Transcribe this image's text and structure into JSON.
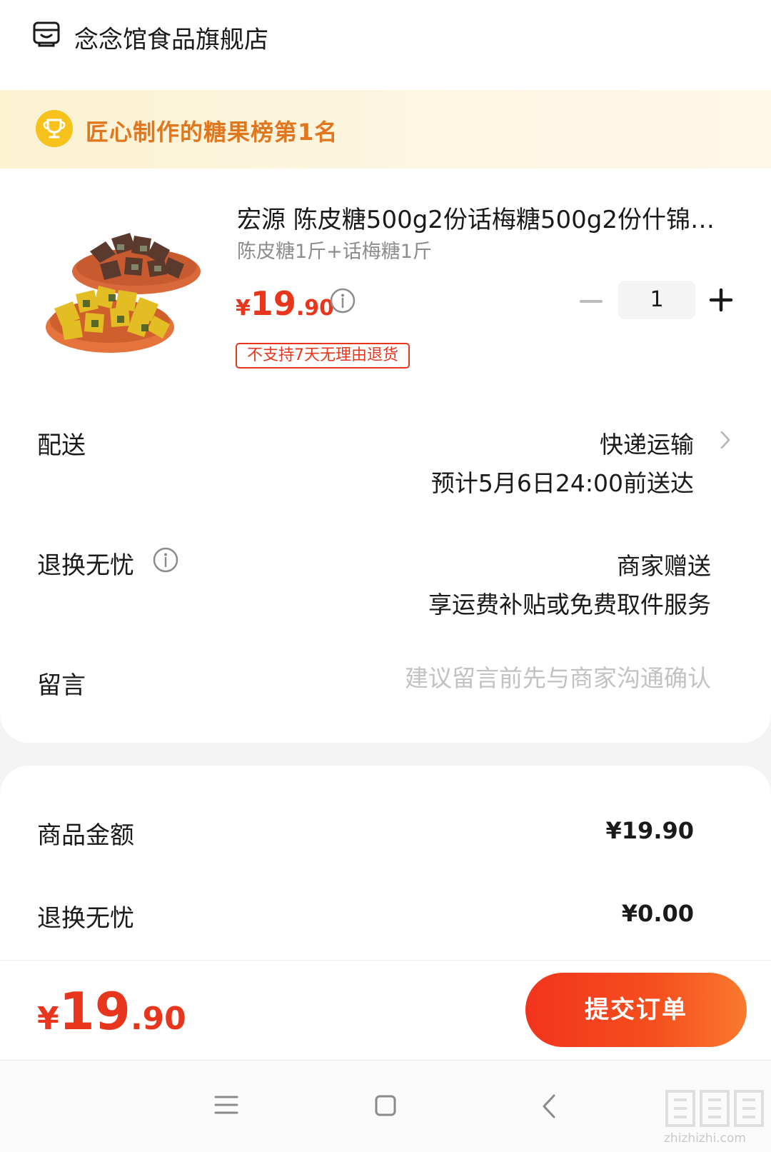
{
  "shop": {
    "name": "念念馆食品旗舰店",
    "icon": "store-icon"
  },
  "rank_banner": {
    "text": "匠心制作的糖果榜第1名",
    "icon": "trophy-icon"
  },
  "product": {
    "title": "宏源 陈皮糖500g2份话梅糖500g2份什锦…",
    "spec": "陈皮糖1斤+话梅糖1斤",
    "price_symbol": "¥",
    "price_int": "19",
    "price_dec": ".90",
    "quantity": "1",
    "return_tag": "不支持7天无理由退货"
  },
  "shipping": {
    "label": "配送",
    "method": "快递运输",
    "eta": "预计5月6日24:00前送达"
  },
  "return_service": {
    "label": "退换无忧",
    "value_line1": "商家赠送",
    "value_line2": "享运费补贴或免费取件服务"
  },
  "message": {
    "label": "留言",
    "placeholder": "建议留言前先与商家沟通确认"
  },
  "summary": {
    "goods_label": "商品金额",
    "goods_value": "¥19.90",
    "return_label": "退换无忧",
    "return_value": "¥0.00"
  },
  "footer": {
    "total_symbol": "¥",
    "total_int": "19",
    "total_dec": ".90",
    "submit_label": "提交订单"
  },
  "colors": {
    "accent_red": "#e8361d",
    "banner_text": "#e0761e",
    "trophy": "#f7c21c"
  },
  "watermark": {
    "text": "zhizhizhi.com"
  }
}
